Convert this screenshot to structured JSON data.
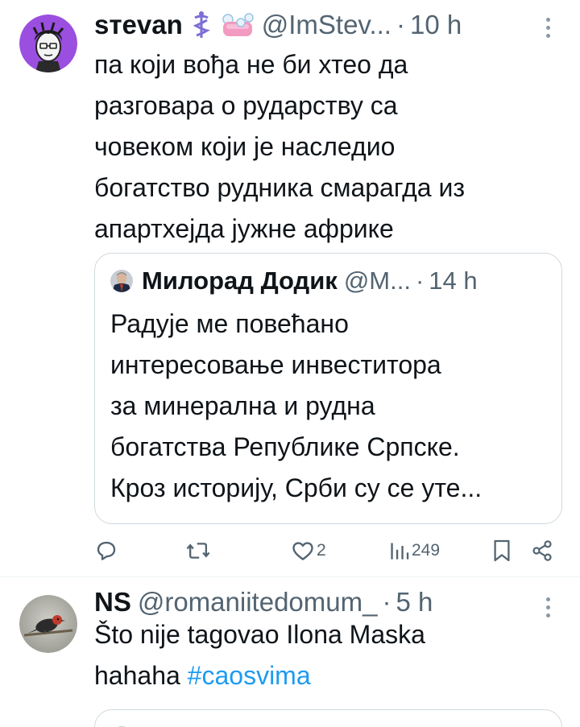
{
  "colors": {
    "text": "#0f1419",
    "secondary": "#536471",
    "link": "#1d9bf0",
    "border": "#cfd9de",
    "avatar_bg_1": "#9b4fe0"
  },
  "tweets": [
    {
      "display_name": "sтevan",
      "emoji_1": "⚕",
      "emoji_2": "🧼",
      "handle": "@ImStev...",
      "dot": "·",
      "time": "10 h",
      "text_lines": [
        "па који вођа не би хтео да",
        "разговара о рударству са",
        "човеком који је наследио",
        "богатство рудника смарагда из",
        "апартхејда јужне африке"
      ],
      "quote": {
        "display_name": "Милорад Додик",
        "handle": "@М...",
        "dot": "·",
        "time": "14 h",
        "text_lines": [
          "Радује ме повећано",
          "интересовање инвеститора",
          "за минерална и рудна",
          "богатства Републике Српске.",
          "Кроз историју, Срби су се уте..."
        ]
      },
      "actions": {
        "reply_icon": "reply-icon",
        "retweet_icon": "retweet-icon",
        "like_icon": "heart-icon",
        "like_count": "2",
        "views_icon": "views-icon",
        "views_count": "249",
        "bookmark_icon": "bookmark-icon",
        "share_icon": "share-icon"
      }
    },
    {
      "display_name": "NS",
      "handle": "@romaniitedomum_",
      "dot": "·",
      "time": "5 h",
      "text_line_1": "Što nije tagovao Ilona Maska",
      "text_line_2_plain": "hahaha ",
      "text_line_2_hashtag": "#caosvima"
    }
  ]
}
